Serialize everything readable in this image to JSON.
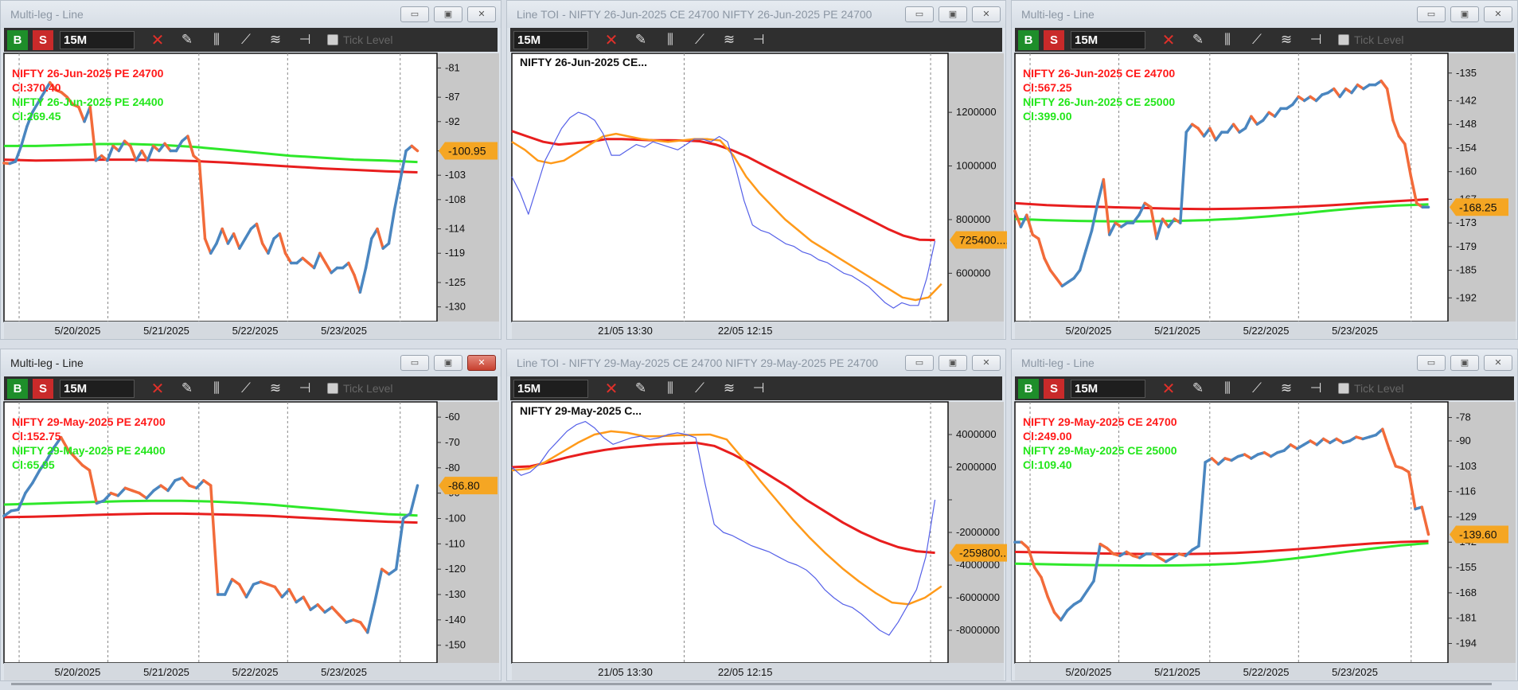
{
  "common": {
    "interval": "15M",
    "buy_label": "B",
    "sell_label": "S",
    "tick_level_label": "Tick Level",
    "min_icon": "minimize-icon",
    "max_icon": "maximize-icon",
    "close_icon": "close-icon"
  },
  "windows": [
    {
      "title": "Multi-leg - Line",
      "active": false,
      "kind": "multileg",
      "legs": [
        {
          "name": "NIFTY 26-Jun-2025 PE 24700",
          "cl": "Cl:370.40",
          "color": "#ff1a1a"
        },
        {
          "name": "NIFTY 26-Jun-2025 PE 24400",
          "cl": "Cl:269.45",
          "color": "#22e61a"
        }
      ],
      "price_tag": "-100.95",
      "chart_data": {
        "type": "line",
        "x_ticks": [
          "5/20/2025",
          "5/21/2025",
          "5/22/2025",
          "5/23/2025"
        ],
        "y_ticks": [
          -81,
          -87,
          -92,
          -98,
          -103,
          -108,
          -114,
          -119,
          -125,
          -130
        ],
        "ylim": [
          -133,
          -78
        ],
        "spread": [
          -100.5,
          -100.6,
          -100.2,
          -97,
          -93,
          -90,
          -88,
          -86,
          -84,
          -85.5,
          -86,
          -87,
          -88.5,
          -89,
          -92,
          -89,
          -100,
          -99,
          -100,
          -97,
          -98,
          -96,
          -97,
          -100,
          -98,
          -100,
          -97,
          -98,
          -96.5,
          -98,
          -98,
          -96,
          -95,
          -99,
          -100,
          -116,
          -119,
          -117,
          -114,
          -117,
          -115,
          -118,
          -116,
          -114,
          -113,
          -117,
          -119,
          -116,
          -115,
          -119,
          -121,
          -121,
          -120,
          -121,
          -122,
          -119,
          -121,
          -123,
          -122,
          -122,
          -121,
          -123.5,
          -127,
          -122,
          -116,
          -114,
          -118,
          -117,
          -110,
          -104,
          -98,
          -97,
          -98
        ],
        "leg2_ma": [
          -97,
          -97,
          -96.8,
          -96.6,
          -96.6,
          -96.8,
          -97.2,
          -97.8,
          -98.4,
          -99,
          -99.4,
          -99.8,
          -100,
          -100.3
        ],
        "leg1_ma": [
          -99.8,
          -100,
          -99.9,
          -99.8,
          -99.8,
          -99.9,
          -100.1,
          -100.4,
          -100.8,
          -101.2,
          -101.6,
          -101.9,
          -102.2,
          -102.4
        ]
      }
    },
    {
      "title": "Line TOI - NIFTY 26-Jun-2025 CE 24700 NIFTY 26-Jun-2025 PE 24700",
      "active": false,
      "kind": "toi",
      "chart_title": "NIFTY 26-Jun-2025 CE...",
      "price_tag": "725400....",
      "chart_data": {
        "type": "line",
        "x_ticks": [
          "21/05 13:30",
          "22/05 12:15"
        ],
        "y_ticks": [
          1200000,
          1000000,
          800000,
          600000
        ],
        "ylim": [
          420000,
          1420000
        ],
        "toi": [
          960000,
          900000,
          820000,
          920000,
          1020000,
          1080000,
          1140000,
          1180000,
          1200000,
          1190000,
          1170000,
          1120000,
          1040000,
          1040000,
          1060000,
          1080000,
          1070000,
          1090000,
          1080000,
          1070000,
          1060000,
          1080000,
          1100000,
          1100000,
          1090000,
          1110000,
          1090000,
          990000,
          870000,
          780000,
          760000,
          750000,
          730000,
          710000,
          700000,
          680000,
          670000,
          650000,
          640000,
          620000,
          600000,
          590000,
          570000,
          550000,
          520000,
          490000,
          470000,
          490000,
          480000,
          480000,
          580000,
          720000
        ],
        "ma_fast": [
          1090000,
          1060000,
          1020000,
          1010000,
          1020000,
          1050000,
          1080000,
          1110000,
          1120000,
          1110000,
          1100000,
          1095000,
          1090000,
          1095000,
          1100000,
          1100000,
          1095000,
          1040000,
          960000,
          900000,
          850000,
          800000,
          760000,
          720000,
          690000,
          660000,
          630000,
          600000,
          570000,
          540000,
          510000,
          500000,
          510000,
          560000
        ],
        "ma_slow": [
          1130000,
          1110000,
          1090000,
          1080000,
          1085000,
          1090000,
          1100000,
          1100000,
          1098000,
          1096000,
          1096000,
          1095000,
          1092000,
          1080000,
          1060000,
          1035000,
          1005000,
          975000,
          945000,
          915000,
          885000,
          855000,
          825000,
          795000,
          765000,
          740000,
          725000,
          724000
        ]
      }
    },
    {
      "title": "Multi-leg - Line",
      "active": false,
      "kind": "multileg",
      "legs": [
        {
          "name": "NIFTY 26-Jun-2025 CE 24700",
          "cl": "Cl:567.25",
          "color": "#ff1a1a"
        },
        {
          "name": "NIFTY 26-Jun-2025 CE 25000",
          "cl": "Cl:399.00",
          "color": "#22e61a"
        }
      ],
      "price_tag": "-168.25",
      "chart_data": {
        "type": "line",
        "x_ticks": [
          "5/20/2025",
          "5/21/2025",
          "5/22/2025",
          "5/23/2025"
        ],
        "y_ticks": [
          -135,
          -142,
          -148,
          -154,
          -160,
          -167,
          -173,
          -179,
          -185,
          -192
        ],
        "ylim": [
          -198,
          -130
        ],
        "spread": [
          -170,
          -174,
          -171,
          -176,
          -177,
          -182,
          -185,
          -187,
          -189,
          -188,
          -187,
          -185,
          -180,
          -175,
          -168,
          -162,
          -176,
          -173,
          -174,
          -173,
          -173,
          -171,
          -168,
          -169,
          -177,
          -172,
          -174,
          -172,
          -173,
          -150,
          -148,
          -149,
          -151,
          -149,
          -152,
          -150,
          -150,
          -148,
          -150,
          -149,
          -146,
          -148,
          -147,
          -145,
          -146,
          -144,
          -144,
          -143,
          -141,
          -142,
          -141,
          -142,
          -140.5,
          -140,
          -139,
          -141,
          -139,
          -140,
          -138,
          -139,
          -138,
          -138,
          -137,
          -139,
          -147,
          -151,
          -153,
          -161,
          -168,
          -169,
          -169
        ],
        "leg1_ma": [
          -168,
          -168.5,
          -168.8,
          -169,
          -169.2,
          -169.4,
          -169.5,
          -169.4,
          -169.2,
          -168.9,
          -168.5,
          -168,
          -167.5,
          -167
        ],
        "leg2_ma": [
          -172,
          -172.3,
          -172.5,
          -172.6,
          -172.6,
          -172.5,
          -172.3,
          -171.9,
          -171.3,
          -170.6,
          -169.8,
          -169.1,
          -168.6,
          -168.3
        ]
      }
    },
    {
      "title": "Multi-leg - Line",
      "active": true,
      "kind": "multileg",
      "legs": [
        {
          "name": "NIFTY 29-May-2025 PE 24700",
          "cl": "Cl:152.75",
          "color": "#ff1a1a"
        },
        {
          "name": "NIFTY 29-May-2025 PE 24400",
          "cl": "Cl:65.95",
          "color": "#22e61a"
        }
      ],
      "price_tag": "-86.80",
      "chart_data": {
        "type": "line",
        "x_ticks": [
          "5/20/2025",
          "5/21/2025",
          "5/22/2025",
          "5/23/2025"
        ],
        "y_ticks": [
          -60,
          -70,
          -80,
          -90,
          -100,
          -110,
          -120,
          -130,
          -140,
          -150
        ],
        "ylim": [
          -157,
          -54
        ],
        "spread": [
          -99,
          -97,
          -96.5,
          -90,
          -86,
          -81,
          -77,
          -72,
          -68,
          -73,
          -76,
          -79,
          -81,
          -94,
          -93,
          -90,
          -91,
          -88,
          -89,
          -90,
          -92,
          -89,
          -87,
          -89,
          -85,
          -84,
          -87,
          -88,
          -85,
          -87,
          -130,
          -130,
          -124,
          -126,
          -131,
          -126,
          -125,
          -126,
          -127,
          -131,
          -128,
          -133,
          -131,
          -136,
          -134,
          -137,
          -135,
          -138,
          -141,
          -140,
          -141,
          -145,
          -133,
          -120,
          -122,
          -120,
          -100,
          -98,
          -87
        ],
        "leg2_ma": [
          -94.5,
          -94.2,
          -93.8,
          -93.5,
          -93.2,
          -93.0,
          -93.0,
          -93.3,
          -93.8,
          -94.5,
          -95.5,
          -96.5,
          -97.5,
          -98.3,
          -98.8
        ],
        "leg1_ma": [
          -99.5,
          -99.3,
          -99.0,
          -98.6,
          -98.3,
          -98.1,
          -98.1,
          -98.3,
          -98.6,
          -99.0,
          -99.6,
          -100.2,
          -100.8,
          -101.3,
          -101.6
        ]
      }
    },
    {
      "title": "Line TOI - NIFTY 29-May-2025 CE 24700 NIFTY 29-May-2025 PE 24700",
      "active": false,
      "kind": "toi",
      "chart_title": "NIFTY 29-May-2025 C...",
      "price_tag": "-259800...",
      "chart_data": {
        "type": "line",
        "x_ticks": [
          "21/05 13:30",
          "22/05 12:15"
        ],
        "y_ticks": [
          4000000,
          2000000,
          0,
          -2000000,
          -4000000,
          -6000000,
          -8000000
        ],
        "y_tick_labels": [
          "4000000",
          "2000000",
          "",
          "-2000000",
          "-4000000",
          "-6000000",
          "-8000000"
        ],
        "ylim": [
          -10000000,
          6000000
        ],
        "toi": [
          2000000,
          1500000,
          1700000,
          2200000,
          3000000,
          3600000,
          4200000,
          4600000,
          4800000,
          4400000,
          3800000,
          3400000,
          3600000,
          3800000,
          3900000,
          3700000,
          3800000,
          4000000,
          4100000,
          4000000,
          3800000,
          1000000,
          -1500000,
          -2000000,
          -2200000,
          -2500000,
          -2800000,
          -3000000,
          -3200000,
          -3500000,
          -3800000,
          -4000000,
          -4300000,
          -4800000,
          -5500000,
          -6000000,
          -6400000,
          -6600000,
          -7000000,
          -7500000,
          -8000000,
          -8300000,
          -7500000,
          -6500000,
          -5500000,
          -3500000,
          0
        ],
        "ma_fast": [
          1800000,
          1900000,
          2300000,
          2900000,
          3500000,
          4000000,
          4200000,
          4100000,
          3900000,
          3900000,
          3950000,
          3980000,
          4000000,
          3700000,
          2500000,
          1200000,
          0,
          -1200000,
          -2300000,
          -3300000,
          -4200000,
          -5000000,
          -5700000,
          -6300000,
          -6400000,
          -6000000,
          -5300000
        ],
        "ma_slow": [
          2000000,
          2050000,
          2300000,
          2600000,
          2850000,
          3050000,
          3200000,
          3300000,
          3400000,
          3450000,
          3500000,
          3300000,
          2800000,
          2200000,
          1500000,
          800000,
          0,
          -700000,
          -1400000,
          -2000000,
          -2500000,
          -2900000,
          -3150000,
          -3250000
        ]
      }
    },
    {
      "title": "Multi-leg - Line",
      "active": false,
      "kind": "multileg",
      "legs": [
        {
          "name": "NIFTY 29-May-2025 CE 24700",
          "cl": "Cl:249.00",
          "color": "#ff1a1a"
        },
        {
          "name": "NIFTY 29-May-2025 CE 25000",
          "cl": "Cl:109.40",
          "color": "#22e61a"
        }
      ],
      "price_tag": "-139.60",
      "chart_data": {
        "type": "line",
        "x_ticks": [
          "5/20/2025",
          "5/21/2025",
          "5/22/2025",
          "5/23/2025"
        ],
        "y_ticks": [
          -78,
          -90,
          -103,
          -116,
          -129,
          -142,
          -155,
          -168,
          -181,
          -194
        ],
        "ylim": [
          -204,
          -70
        ],
        "spread": [
          -142,
          -142,
          -145,
          -155,
          -160,
          -170,
          -178,
          -182,
          -177,
          -174,
          -172,
          -167,
          -162,
          -143,
          -145,
          -148,
          -149,
          -147,
          -149,
          -150,
          -148,
          -148,
          -150,
          -152,
          -150,
          -148,
          -149,
          -146,
          -144,
          -101,
          -99,
          -102,
          -99,
          -100,
          -98,
          -97,
          -99,
          -97,
          -96,
          -98,
          -96,
          -95,
          -92,
          -94,
          -92,
          -90,
          -92,
          -89,
          -91,
          -89,
          -91,
          -90,
          -88,
          -89,
          -88,
          -87,
          -84,
          -94,
          -103,
          -104,
          -106,
          -125,
          -124,
          -138
        ],
        "leg1_ma": [
          -147,
          -147.2,
          -147.5,
          -147.8,
          -148,
          -148.1,
          -148.1,
          -147.9,
          -147.5,
          -146.8,
          -145.9,
          -144.8,
          -143.6,
          -142.6,
          -141.9,
          -141.5
        ],
        "leg2_ma": [
          -153,
          -153.3,
          -153.6,
          -153.8,
          -153.9,
          -154,
          -153.9,
          -153.6,
          -153,
          -152,
          -150.6,
          -148.9,
          -147,
          -145.2,
          -143.6,
          -142.5
        ]
      }
    }
  ],
  "colors": {
    "chart_bg": "#ffffff",
    "axis_panel": "#c8c8c8",
    "spread_up": "#4a86c0",
    "spread_down": "#f26b3a",
    "ma_fast": "#ff9a1a",
    "ma_slow": "#e81e1e",
    "toi_line": "#5560e8",
    "price_tag_bg": "#f5a623"
  }
}
